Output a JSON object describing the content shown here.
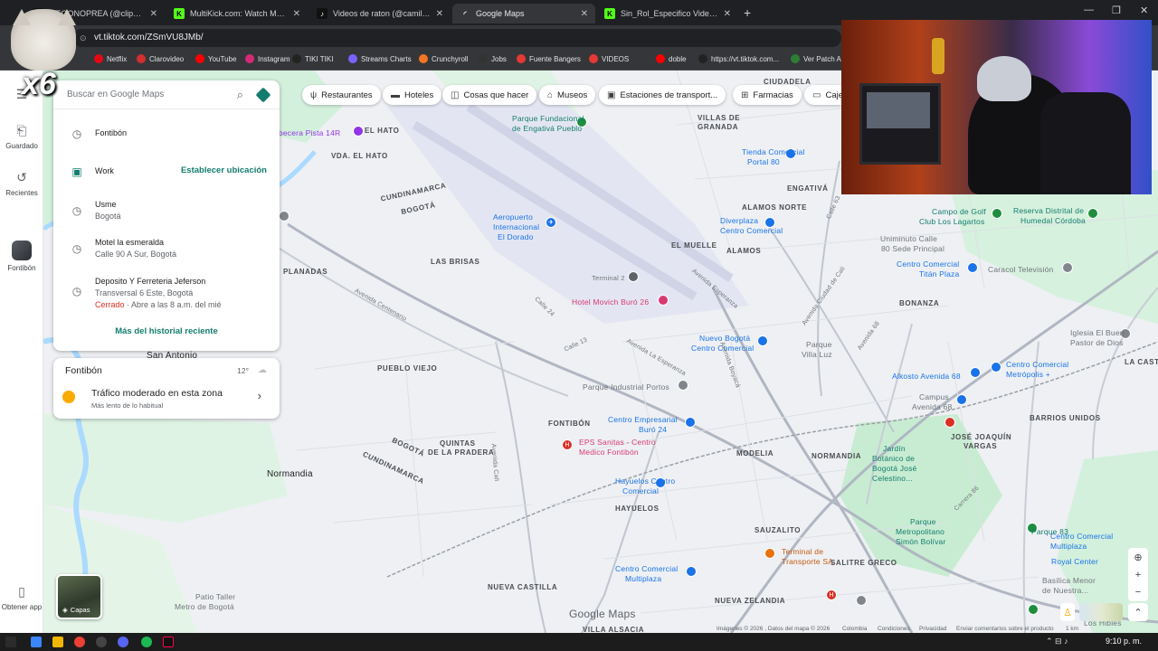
{
  "browser": {
    "tabs": [
      {
        "title": "MEGONOPREA (@clips_megon",
        "favicon": "tiktok",
        "active": false
      },
      {
        "title": "MultiKick.com: Watch Multiple",
        "favicon": "kick",
        "active": false
      },
      {
        "title": "Videos de raton (@camilotech",
        "favicon": "tiktok",
        "active": false
      },
      {
        "title": "Google Maps",
        "favicon": "loading",
        "active": true
      },
      {
        "title": "Sin_Rol_Especifico Videos - Wat",
        "favicon": "kick",
        "active": false
      }
    ],
    "url": "vt.tiktok.com/ZSmVU8JMb/",
    "bookmarks": [
      {
        "label": "Netflix",
        "color": "#e50914"
      },
      {
        "label": "Clarovideo",
        "color": "#d32f2f"
      },
      {
        "label": "YouTube",
        "color": "#ff0000"
      },
      {
        "label": "Instagram",
        "color": "#d62976"
      },
      {
        "label": "TIKI TIKI",
        "color": "#222222"
      },
      {
        "label": "Streams Charts",
        "color": "#7b61ff"
      },
      {
        "label": "Crunchyroll",
        "color": "#f47521"
      },
      {
        "label": "Jobs",
        "color": "#333333"
      },
      {
        "label": "Fuente Bangers",
        "color": "#e53935"
      },
      {
        "label": "VIDEOS",
        "color": "#e53935"
      },
      {
        "label": "doble",
        "color": "#ff0000"
      },
      {
        "label": "https://vt.tiktok.com...",
        "color": "#222222"
      },
      {
        "label": "Ver Patch Ac",
        "color": "#2e7d32"
      }
    ]
  },
  "overlay": {
    "multiplier": "x6"
  },
  "rail": {
    "saved": "Guardado",
    "recent": "Recientes",
    "place": "Fontibón",
    "get_app": "Obtener app"
  },
  "search": {
    "placeholder": "Buscar en Google Maps",
    "history": [
      {
        "title": "Fontibón",
        "sub": "",
        "icon": "clock-icon"
      },
      {
        "title": "Work",
        "sub": "",
        "icon": "briefcase-icon",
        "action": "Establecer ubicación"
      },
      {
        "title": "Usme",
        "sub": "Bogotá",
        "icon": "clock-icon"
      },
      {
        "title": "Motel la esmeralda",
        "sub": "Calle 90 A Sur, Bogotá",
        "icon": "clock-icon"
      },
      {
        "title": "Deposito Y Ferreteria Jeferson",
        "sub": "Transversal 6 Este, Bogotá",
        "status": "Cerrado",
        "hours": " · Abre a las 8 a.m. del mié",
        "icon": "clock-icon"
      }
    ],
    "more": "Más del historial reciente"
  },
  "traffic": {
    "place": "Fontibón",
    "temp": "12°",
    "status": "Tráfico moderado en esta zona",
    "detail": "Más lento de lo habitual"
  },
  "chips": [
    "Restaurantes",
    "Hoteles",
    "Cosas que hacer",
    "Museos",
    "Estaciones de transport...",
    "Farmacias",
    "Caje"
  ],
  "map": {
    "labels": {
      "villas_de_granada": "VILLAS DE",
      "villas_de_granada2": "GRANADA",
      "ciudadela": "CIUDADELA",
      "parque_engativa": "Parque Fundacional",
      "parque_engativa2": "de Engativá Pueblo",
      "cabecera": "abecera Pista 14R",
      "el_hato": "EL HATO",
      "vda_el_hato": "VDA. EL HATO",
      "cundinamarca1": "CUNDINAMARCA",
      "bogota1": "BOGOTÁ",
      "aeropuerto": "Aeropuerto",
      "aeropuerto2": "Internacional",
      "aeropuerto3": "El Dorado",
      "tc_portal80": "Tienda Comercial",
      "tc_portal80_2": "Portal 80",
      "engativa": "ENGATIVÁ",
      "alamos_norte": "ALAMOS NORTE",
      "diverplaza": "Diverplaza",
      "diverplaza2": "Centro Comercial",
      "el_muelle": "EL MUELLE",
      "alamos": "ALAMOS",
      "campo_de_golf": "Campo de Golf",
      "campo_de_golf2": "Club Los Lagartos",
      "hospital": "Reserva Distrital de",
      "hospital2": "Humedal Córdoba",
      "uniminuto": "Uniminuto Calle",
      "uniminuto2": "80 Sede Principal",
      "titan": "Centro Comercial",
      "titan2": "Titán Plaza",
      "caracol": "Caracol Televisión",
      "las_brisas": "LAS BRISAS",
      "planadas": "PLANADAS",
      "terminal2": "Terminal 2",
      "hotel_movich": "Hotel Movich Buró 26",
      "bonanza": "BONANZA",
      "nuevo_bogota": "Nuevo Bogotá",
      "nuevo_bogota2": "Centro Comercial",
      "parque_villa_luz": "Parque",
      "parque_villa_luz2": "Villa Luz",
      "iglesia": "Iglesia El Buen",
      "iglesia2": "Pastor de Dios",
      "la_castellana": "LA CASTE",
      "san_antonio": "San Antonio",
      "pueblo_viejo": "PUEBLO VIEJO",
      "parque_industrial": "Parque Industrial Portos",
      "alkosto": "Alkosto Avenida 68",
      "metropolis": "Centro Comercial",
      "metropolis2": "Metrópolis +",
      "campus": "Campus",
      "campus2": "Avenida 68",
      "barrios_unidos": "BARRIOS UNIDOS",
      "fontibon": "FONTIBÓN",
      "tc_buro24": "Centro Empresarial",
      "tc_buro24_2": "Buró 24",
      "eps": "EPS Sanitas - Centro",
      "eps2": "Medico Fontibón",
      "quintas": "QUINTAS",
      "quintas2": "DE LA PRADERA",
      "modelia": "MODELIA",
      "normandia_big": "Normandia",
      "normandia": "NORMANDIA",
      "jose_joaquin": "JOSÉ JOAQUÍN",
      "jose_joaquin2": "VARGAS",
      "jardin": "Jardín",
      "jardin2": "Botánico de",
      "jardin3": "Bogotá José",
      "jardin4": "Celestino...",
      "hayuelos_cc": "Hayuelos Centro",
      "hayuelos_cc2": "Comercial",
      "hayuelos": "HAYUELOS",
      "cundinamarca2": "CUNDINAMARCA",
      "bogota2": "BOGOTÁ",
      "parque83": "Parque 83",
      "sauzalito": "SAUZALITO",
      "terminal_sa": "Terminal de",
      "terminal_sa2": "Transporte SA",
      "salitre": "SALITRE GRECO",
      "parque_simon": "Parque",
      "parque_simon2": "Metropolitano",
      "parque_simon3": "Simón Bolívar",
      "royal_center": "Royal Center",
      "multiplaza": "Centro Comercial",
      "multiplaza2": "Multiplaza",
      "basilica": "Basílica Menor",
      "basilica2": "de Nuestra...",
      "patio_taller": "Patio Taller",
      "patio_taller2": "Metro de Bogotá",
      "nueva_castilla": "NUEVA CASTILLA",
      "nueva_zelandia": "NUEVA ZELANDIA",
      "villa_alsacia": "VILLA ALSACIA",
      "los_hibiles": "Los Hibles",
      "calle_63": "Calle 63",
      "calle_24": "Calle 24",
      "av_esperanza": "Avenida Esperanza",
      "av_centenario": "Avenida Centenario",
      "av_boyaca": "Avenida Boyacá",
      "av_68": "Avenida 68",
      "av_cali": "Avenida Cali",
      "av_ciudad_cali": "Avenida Ciudad de Cali",
      "av_la_esperanza": "Avenida La Esperanza",
      "carrera_86": "Carrera 86",
      "calle_13": "Calle 13"
    },
    "google_maps": "Google Maps",
    "layers": "Capas",
    "attribution": [
      "Imágenes © 2026 , Datos del mapa © 2026",
      "Colombia",
      "Términos",
      "Condiciones",
      "Privacidad",
      "Enviar comentarios sobre el producto",
      "1 km"
    ]
  },
  "taskbar": {
    "time": "9:10 p. m."
  },
  "colors": {
    "accent_teal": "#137c6e",
    "map_bg": "#eef0f3",
    "water": "#aadaff",
    "green": "#c8efd0"
  }
}
